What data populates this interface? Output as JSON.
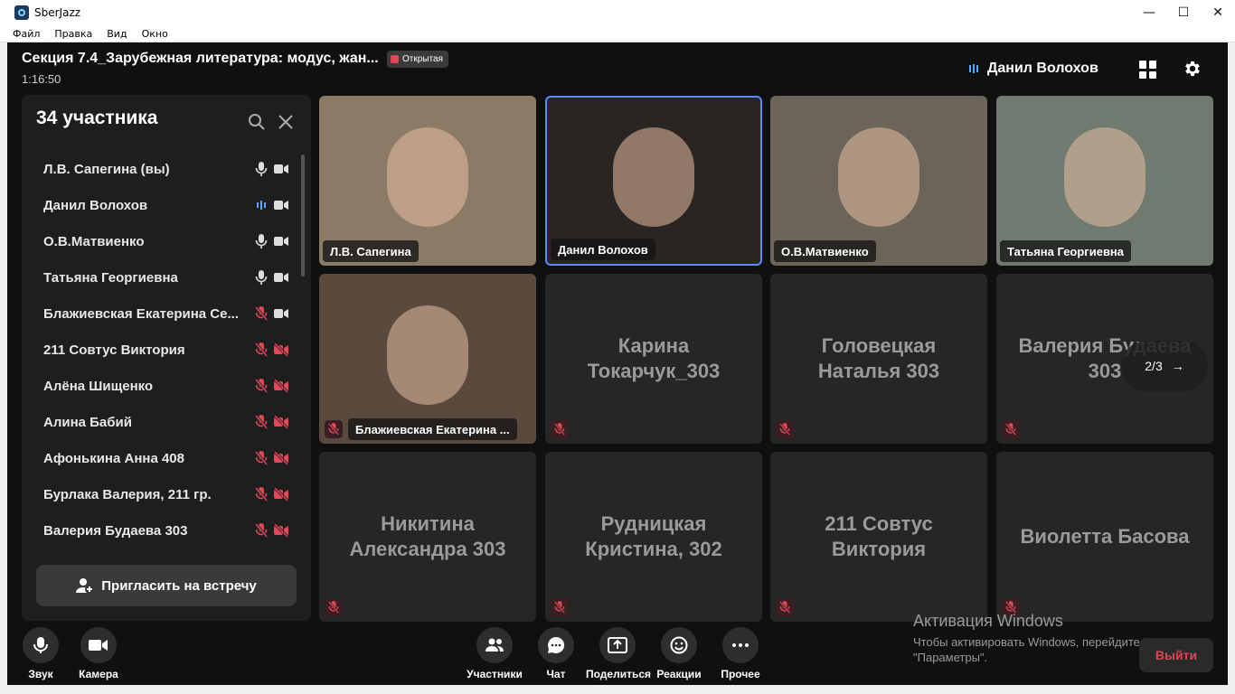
{
  "window": {
    "title": "SberJazz",
    "controls": [
      "—",
      "☐",
      "✕"
    ]
  },
  "menu": [
    "Файл",
    "Правка",
    "Вид",
    "Окно"
  ],
  "header": {
    "meeting_title": "Секция 7.4_Зарубежная литература: модус, жан...",
    "badge": "Открытая",
    "timer": "1:16:50",
    "speaker": "Данил Волохов"
  },
  "panel": {
    "count_label": "34 участника",
    "invite_label": "Пригласить на встречу",
    "participants": [
      {
        "name": "Л.В. Сапегина (вы)",
        "mic": "on",
        "cam": "on"
      },
      {
        "name": "Данил Волохов",
        "mic": "speaking",
        "cam": "on"
      },
      {
        "name": "О.В.Матвиенко",
        "mic": "on",
        "cam": "on"
      },
      {
        "name": "Татьяна Георгиевна",
        "mic": "on",
        "cam": "on"
      },
      {
        "name": "Блажиевская Екатерина Се...",
        "mic": "off",
        "cam": "on"
      },
      {
        "name": "211 Совтус Виктория",
        "mic": "off",
        "cam": "off"
      },
      {
        "name": "Алёна Шищенко",
        "mic": "off",
        "cam": "off"
      },
      {
        "name": "Алина Бабий",
        "mic": "off",
        "cam": "off"
      },
      {
        "name": "Афонькина Анна 408",
        "mic": "off",
        "cam": "off"
      },
      {
        "name": "Бурлака Валерия, 211 гр.",
        "mic": "off",
        "cam": "off"
      },
      {
        "name": "Валерия Будаева 303",
        "mic": "off",
        "cam": "off"
      }
    ]
  },
  "tiles": [
    {
      "name": "Л.В. Сапегина",
      "type": "video"
    },
    {
      "name": "Данил Волохов",
      "type": "video"
    },
    {
      "name": "О.В.Матвиенко",
      "type": "video"
    },
    {
      "name": "Татьяна Георгиевна",
      "type": "video"
    },
    {
      "name": "Блажиевская Екатерина ...",
      "type": "video"
    },
    {
      "name": "Карина Токарчук_303",
      "type": "placeholder"
    },
    {
      "name": "Головецкая Наталья 303",
      "type": "placeholder"
    },
    {
      "name": "Валерия Будаева 303",
      "type": "placeholder"
    },
    {
      "name": "Никитина Александра 303",
      "type": "placeholder"
    },
    {
      "name": "Рудницкая Кристина, 302",
      "type": "placeholder"
    },
    {
      "name": "211 Совтус Виктория",
      "type": "placeholder"
    },
    {
      "name": "Виолетта Басова",
      "type": "placeholder"
    }
  ],
  "page_nav": "2/3",
  "toolbar": {
    "sound": "Звук",
    "camera": "Камера",
    "participants": "Участники",
    "chat": "Чат",
    "share": "Поделиться",
    "reactions": "Реакции",
    "more": "Прочее",
    "exit": "Выйти"
  },
  "watermark": {
    "line1": "Активация Windows",
    "line2": "Чтобы активировать Windows, перейдите в раздел \"Параметры\"."
  },
  "colors": {
    "accent": "#5a8dff",
    "danger": "#e24656",
    "background": "#101010"
  }
}
